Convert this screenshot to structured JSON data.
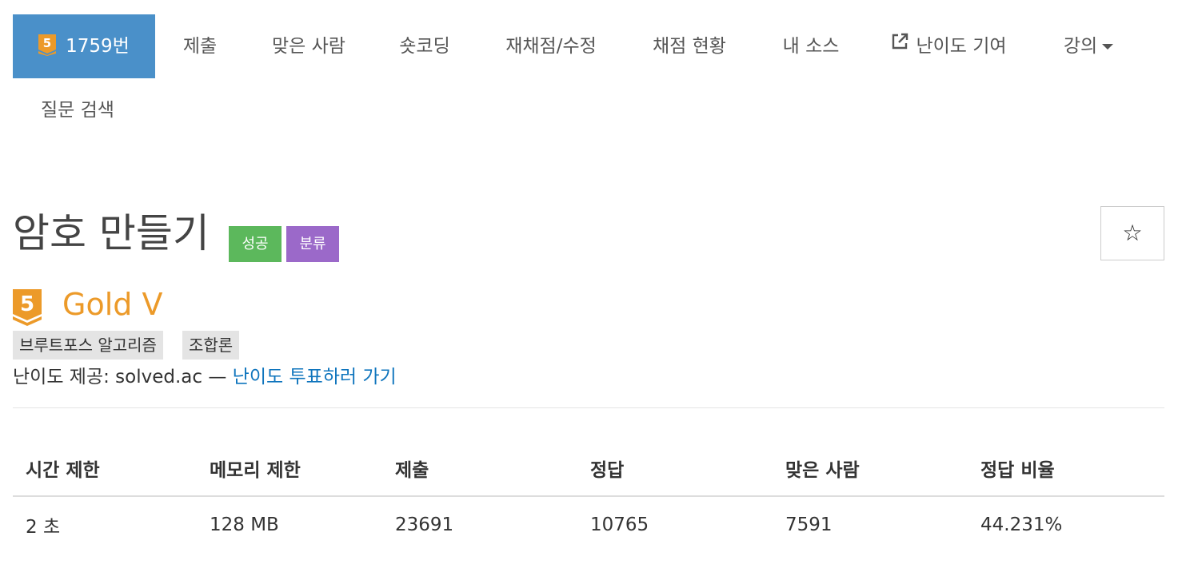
{
  "nav": {
    "tier_badge_number": "5",
    "items": [
      {
        "label": "1759번"
      },
      {
        "label": "제출"
      },
      {
        "label": "맞은 사람"
      },
      {
        "label": "숏코딩"
      },
      {
        "label": "재채점/수정"
      },
      {
        "label": "채점 현황"
      },
      {
        "label": "내 소스"
      },
      {
        "label": "난이도 기여",
        "icon": "external-link-icon"
      },
      {
        "label": "강의",
        "icon": "caret-down-icon"
      },
      {
        "label": "질문 검색"
      }
    ]
  },
  "problem": {
    "title": "암호 만들기",
    "labels": {
      "success": "성공",
      "category": "분류"
    },
    "star_glyph": "☆",
    "tier": {
      "number": "5",
      "name": "Gold V",
      "color": "#ec9a29"
    },
    "tags": [
      "브루트포스 알고리즘",
      "조합론"
    ],
    "difficulty_prefix": "난이도 제공: solved.ac — ",
    "difficulty_link": "난이도 투표하러 가기"
  },
  "table": {
    "headers": [
      "시간 제한",
      "메모리 제한",
      "제출",
      "정답",
      "맞은 사람",
      "정답 비율"
    ],
    "rows": [
      [
        "2 초",
        "128 MB",
        "23691",
        "10765",
        "7591",
        "44.231%"
      ]
    ]
  },
  "colors": {
    "nav_active": "#4a90c9",
    "success": "#5cb85c",
    "category": "#9b69c9",
    "link": "#0f75bd",
    "gold": "#ec9a29"
  }
}
